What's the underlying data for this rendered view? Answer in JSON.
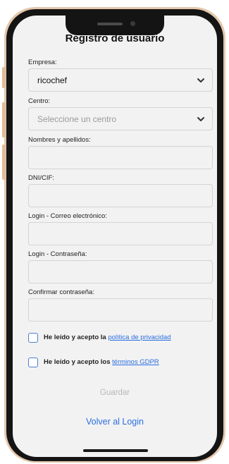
{
  "title": "Registro de usuario",
  "form": {
    "empresa_label": "Empresa:",
    "empresa_value": "ricochef",
    "centro_label": "Centro:",
    "centro_placeholder": "Seleccione un centro",
    "nombres_label": "Nombres y apellidos:",
    "dni_label": "DNI/CIF:",
    "email_label": "Login - Correo electrónico:",
    "password_label": "Login - Contraseña:",
    "confirm_label": "Confirmar contraseña:"
  },
  "checkboxes": {
    "privacy_prefix": "He leído y acepto la ",
    "privacy_link": "política de privacidad",
    "gdpr_prefix": "He leído y acepto los ",
    "gdpr_link": "términos GDPR"
  },
  "buttons": {
    "save": "Guardar",
    "back_to_login": "Volver al Login"
  },
  "colors": {
    "link": "#2a6fe0",
    "checkbox_border": "#4a7fd0",
    "disabled_text": "#b8b8b8",
    "phone_frame": "#e4c7ac"
  },
  "icons": {
    "select_arrow": "chevron-down-icon"
  }
}
